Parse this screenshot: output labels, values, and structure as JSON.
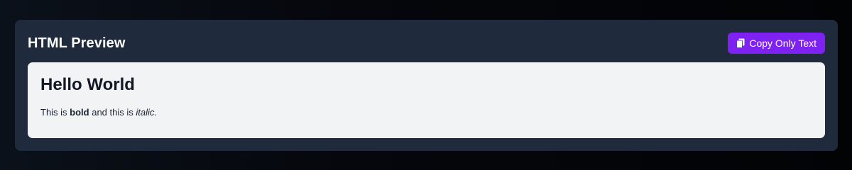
{
  "panel": {
    "title": "HTML Preview",
    "copy_button": {
      "label": "Copy Only Text",
      "icon": "copy-icon"
    }
  },
  "preview": {
    "heading": "Hello World",
    "paragraph": {
      "part1": "This is ",
      "bold": "bold",
      "part2": " and this is ",
      "italic": "italic",
      "part3": "."
    }
  },
  "colors": {
    "accent": "#7e22f2",
    "panel_bg": "#1f2a3c",
    "preview_bg": "#f2f3f5"
  }
}
